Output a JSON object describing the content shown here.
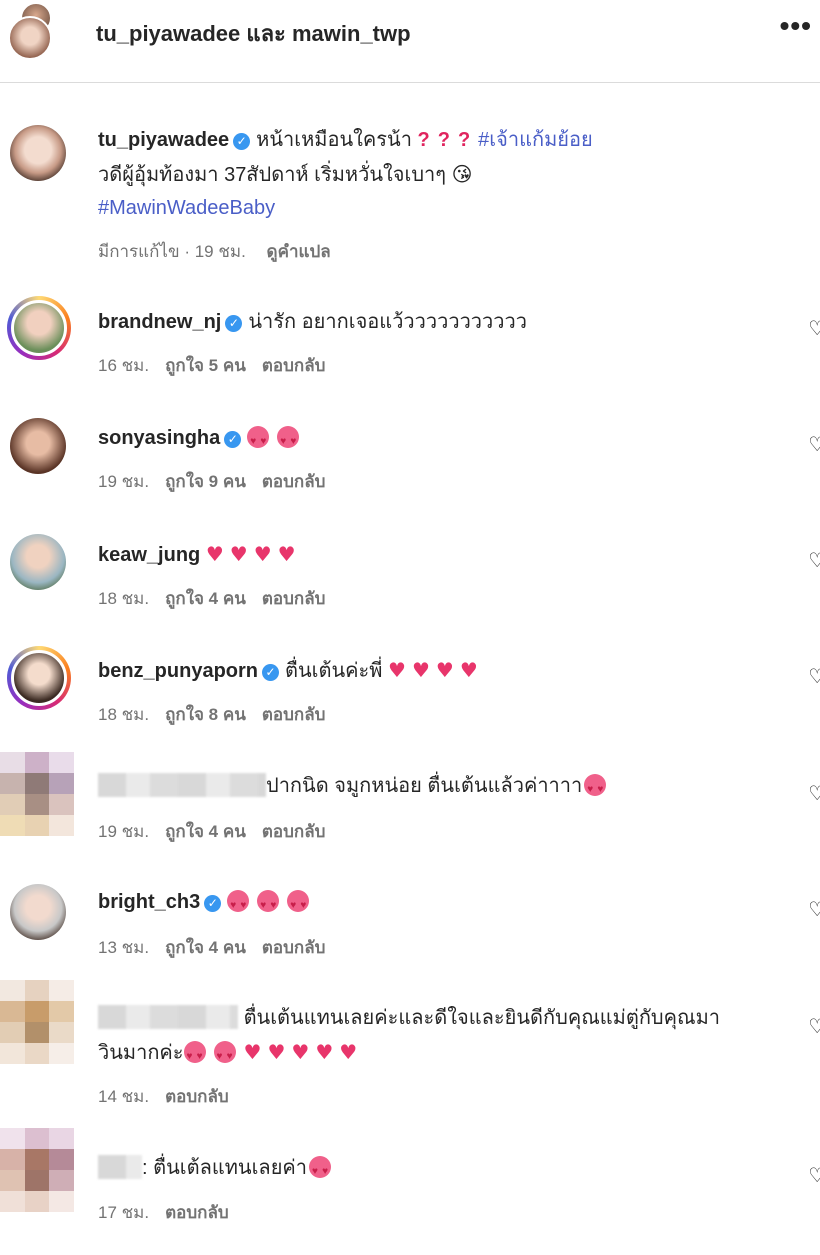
{
  "header": {
    "title": "tu_piyawadee และ mawin_twp",
    "more": "•••"
  },
  "post": {
    "username": "tu_piyawadee",
    "text1": "หน้าเหมือนใครน้า",
    "hashtag1": "#เจ้าแก้มย้อย",
    "text2": "วดีผู้อุ้มท้องมา 37สัปดาห์ เริ่มหวั่นใจเบาๆ",
    "emoji2": "😘",
    "hashtag2": "#MawinWadeeBaby",
    "meta": "มีการแก้ไข · 19 ชม.",
    "translate": "ดูคำแปล"
  },
  "comments": [
    {
      "username": "brandnew_nj",
      "verified": true,
      "text": "น่ารัก อยากเจอแว้ววววววววววว",
      "time": "16 ชม.",
      "likes": "ถูกใจ 5 คน",
      "reply": "ตอบกลับ"
    },
    {
      "username": "sonyasingha",
      "verified": true,
      "text": "",
      "time": "19 ชม.",
      "likes": "ถูกใจ 9 คน",
      "reply": "ตอบกลับ"
    },
    {
      "username": "keaw_jung",
      "verified": false,
      "text": "",
      "time": "18 ชม.",
      "likes": "ถูกใจ 4 คน",
      "reply": "ตอบกลับ"
    },
    {
      "username": "benz_punyaporn",
      "verified": true,
      "text": "ตื่นเต้นค่ะพี่",
      "time": "18 ชม.",
      "likes": "ถูกใจ 8 คน",
      "reply": "ตอบกลับ"
    },
    {
      "username": "",
      "verified": false,
      "text": "ปากนิด จมูกหน่อย ตื่นเต้นแล้วค่าาาา",
      "time": "19 ชม.",
      "likes": "ถูกใจ 4 คน",
      "reply": "ตอบกลับ"
    },
    {
      "username": "bright_ch3",
      "verified": true,
      "text": "",
      "time": "13 ชม.",
      "likes": "ถูกใจ 4 คน",
      "reply": "ตอบกลับ"
    },
    {
      "username": "",
      "verified": false,
      "text": "ตื่นเต้นแทนเลยค่ะและดีใจและยินดีกับคุณแม่ตู่กับคุณมา",
      "text2": "วินมากค่ะ",
      "time": "14 ชม.",
      "likes": "",
      "reply": "ตอบกลับ"
    },
    {
      "username": "",
      "verified": false,
      "text": ": ตื่นเต้ลแทนเลยค่า",
      "time": "17 ชม.",
      "likes": "",
      "reply": "ตอบกลับ"
    }
  ],
  "icons": {
    "verified": "verified-badge-icon",
    "like": "heart-outline-icon",
    "more": "more-options-icon"
  },
  "colors": {
    "link": "#4a5ec7",
    "verified": "#3897f0",
    "meta": "#737373",
    "heart": "#e8356b"
  }
}
